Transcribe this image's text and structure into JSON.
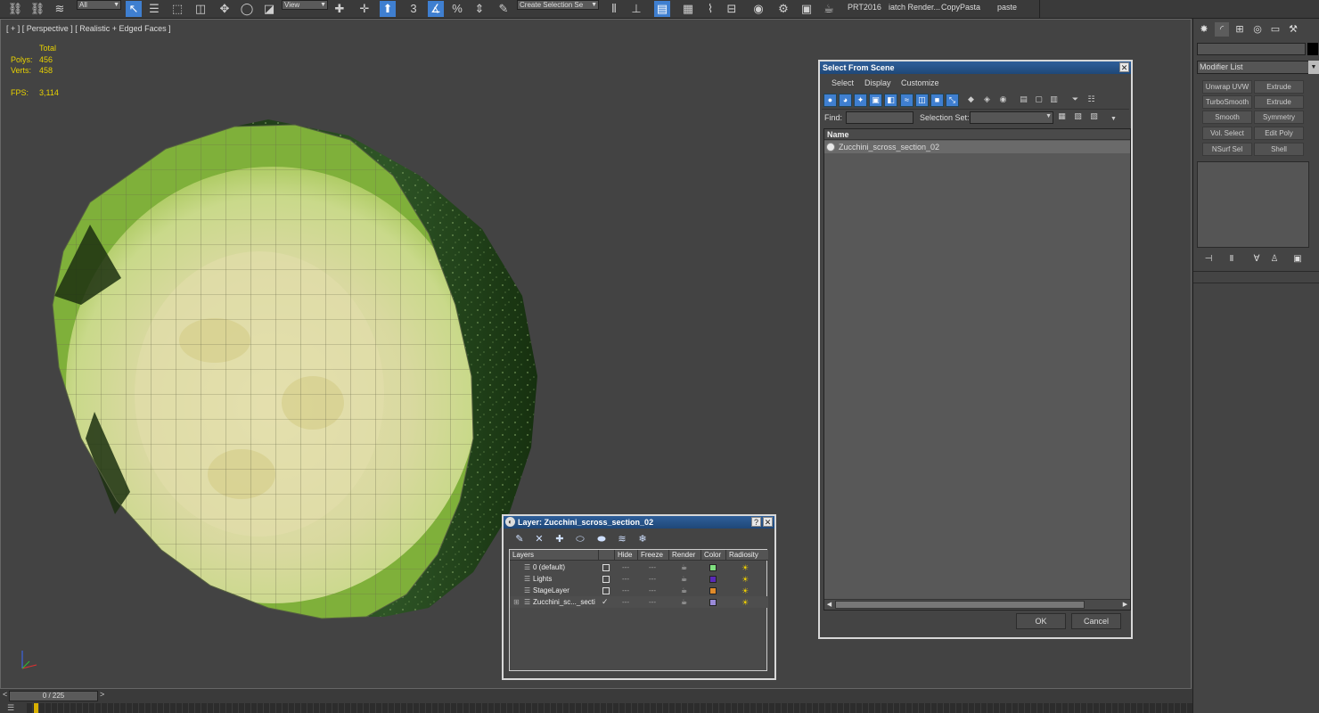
{
  "toolbar": {
    "selection_filter": "All",
    "ref_coord": "View",
    "snap_label": "3",
    "named_selection_placeholder": "Create Selection Se",
    "scripts": [
      "PRT2016",
      "iatch Render...",
      "CopyPasta",
      "paste"
    ]
  },
  "viewport": {
    "label": "[ + ] [ Perspective ] [ Realistic + Edged Faces ]",
    "stats": {
      "total_label": "Total",
      "polys_label": "Polys:",
      "polys_value": "456",
      "verts_label": "Verts:",
      "verts_value": "458",
      "fps_label": "FPS:",
      "fps_value": "3,114"
    }
  },
  "command_panel": {
    "modifier_list_label": "Modifier List",
    "modifier_buttons": [
      "Unwrap UVW",
      "Extrude",
      "TurboSmooth",
      "Extrude",
      "Smooth",
      "Symmetry",
      "Vol. Select",
      "Edit Poly",
      "NSurf Sel",
      "Shell"
    ]
  },
  "select_from_scene": {
    "title": "Select From Scene",
    "menu": [
      "Select",
      "Display",
      "Customize"
    ],
    "find_label": "Find:",
    "selection_set_label": "Selection Set:",
    "column_name": "Name",
    "objects": [
      "Zucchini_scross_section_02"
    ],
    "ok_label": "OK",
    "cancel_label": "Cancel"
  },
  "layer_dialog": {
    "title": "Layer: Zucchini_scross_section_02",
    "help_label": "?",
    "columns": [
      "Layers",
      "Hide",
      "Freeze",
      "Render",
      "Color",
      "Radiosity"
    ],
    "layers": [
      {
        "name": "0 (default)",
        "color": "#7fe07f",
        "current": false
      },
      {
        "name": "Lights",
        "color": "#5a2ab8",
        "current": false
      },
      {
        "name": "StageLayer",
        "color": "#e08a2a",
        "current": false
      },
      {
        "name": "Zucchini_sc..._secti",
        "color": "#9a8ad8",
        "current": true
      }
    ]
  },
  "timeline": {
    "frame_readout": "0 / 225",
    "prev_label": "<",
    "next_label": ">"
  },
  "colors": {
    "accent_blue": "#3f7fd0",
    "title_blue": "#2f5f9a",
    "stats_yellow": "#e8d200"
  }
}
